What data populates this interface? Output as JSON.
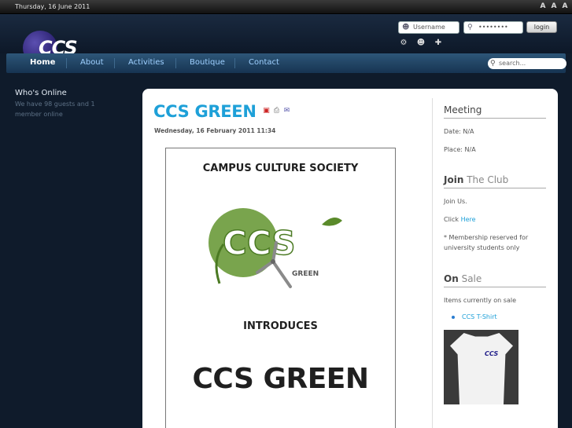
{
  "topbar": {
    "date": "Thursday, 16 June 2011",
    "font_controls": [
      "A",
      "A",
      "A"
    ]
  },
  "logo": {
    "text": "CCS"
  },
  "login": {
    "username_placeholder": "Username",
    "password_value": "••••••••",
    "button": "login"
  },
  "nav": {
    "items": [
      "Home",
      "About",
      "Activities",
      "Boutique",
      "Contact"
    ],
    "active": "Home",
    "search_placeholder": "search..."
  },
  "whos_online": {
    "heading": "Who's Online",
    "text": "We have 98 guests and 1 member online"
  },
  "article": {
    "title": "CCS GREEN",
    "date": "Wednesday, 16 February 2011 11:34",
    "poster": {
      "heading": "CAMPUS CULTURE SOCIETY",
      "logo_text": "CCS",
      "logo_sub": "GREEN",
      "introduces": "INTRODUCES",
      "big": "CCS GREEN"
    }
  },
  "sidebar": {
    "meeting": {
      "heading": "Meeting",
      "date": "Date: N/A",
      "place": "Place: N/A"
    },
    "join": {
      "heading_bold": "Join",
      "heading_light": "The Club",
      "line1": "Join Us.",
      "click_prefix": "Click ",
      "click_link": "Here",
      "note": "* Membership reserved for university students only"
    },
    "sale": {
      "heading_bold": "On",
      "heading_light": "Sale",
      "intro": "Items currently on sale",
      "items": [
        "CCS T-Shirt"
      ],
      "shirt_logo": "CCS"
    }
  },
  "colors": {
    "accent": "#1ea0d8",
    "nav_bg": "#1f4566",
    "page_bg": "#0f1b2b",
    "green": "#6a9a3a"
  },
  "icons": {
    "user_field": "user-icon",
    "password_field": "key-icon",
    "search": "search-icon",
    "pdf": "pdf-icon",
    "print": "print-icon",
    "email": "email-icon"
  }
}
